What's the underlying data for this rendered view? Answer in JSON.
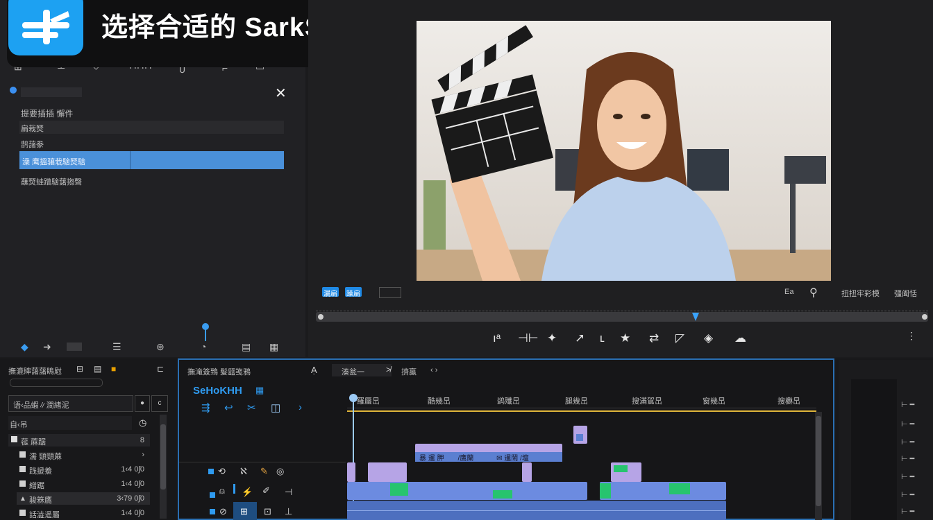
{
  "banner": {
    "title": "选择合适的 SarkSnrt",
    "logo_icon": "app-logo-icon"
  },
  "left_panel": {
    "close_label": "✕",
    "heading": "提要插插 懈件",
    "rows": [
      "扁栽燹",
      "鹄藷豢",
      "澡 鹰搵骧栽騇燹騇",
      "蘸燹蛙蹭騇藷搊聲"
    ],
    "selected_index": 2
  },
  "viewer": {
    "badge_1": "漏扁",
    "badge_2": "躁扁",
    "right_label_1": "Ea",
    "right_label_2": "扭扭牢彩模",
    "right_label_3": "彊阖恬",
    "controls": [
      "ıᵃ",
      "⊣⊢",
      "✦",
      "↗",
      "ʟ",
      "★",
      "⇄",
      "◸",
      "◈",
      "☁"
    ]
  },
  "project": {
    "title": "撫漉賗藷藷瞗屗",
    "search_placeholder": "",
    "filter_label": "语‹品蝦∥澗緖泥",
    "folder_label": "自‹吊",
    "items": [
      {
        "name": "蓰 蔴踞",
        "meta": "8"
      },
      {
        "name": "濡 頸頸蔴",
        "meta": "›"
      },
      {
        "name": "践搋鯗",
        "meta": "1‹4 0ʃ0"
      },
      {
        "name": "繒踞",
        "meta": "1‹4 0ʃ0"
      },
      {
        "name": "骏箖鷹",
        "meta": "3‹79 0ʃ0"
      },
      {
        "name": "話澁遥屬",
        "meta": "1‹4 0ʃ0"
      }
    ]
  },
  "timeline": {
    "header_1": "撫滝簽鵄 髮瓥笺鴉",
    "dropdown": "湊瓮一",
    "label_2": "擠蠃",
    "sequence_name": "SeHoKHH",
    "timecodes": [
      "羅蜃旵",
      "酷幾旵",
      "鹢殲旵",
      "腿幾旵",
      "搜滿鴐旵",
      "窗幾旵",
      "搜欁旵"
    ],
    "clip_label": "暴 暹 胛　　/鷹蘭　　　 ✉ 暹鬧 /壇"
  },
  "colors": {
    "accent": "#4a90d9",
    "clip_purple": "#b6a4e6",
    "clip_blue": "#5b7fd1",
    "clip_green": "#27c46e",
    "playhead": "#e0b63a"
  }
}
